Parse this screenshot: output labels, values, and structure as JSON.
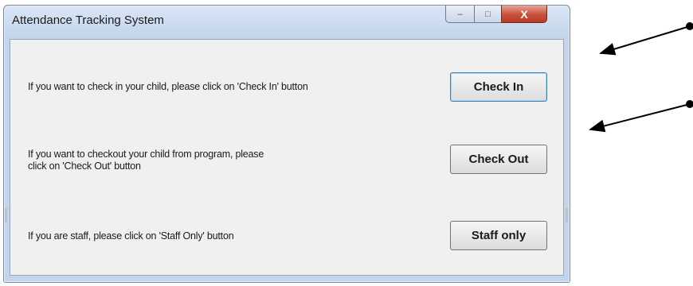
{
  "window": {
    "title": "Attendance Tracking System",
    "controls": {
      "minimize": "–",
      "maximize": "□",
      "close": "X"
    }
  },
  "rows": [
    {
      "text": "If you want to check in your child, please click on 'Check In' button",
      "button": "Check In"
    },
    {
      "text": "If you want to checkout your child from program, please\nclick on 'Check Out' button",
      "button": "Check Out"
    },
    {
      "text": "If you are staff, please click on 'Staff Only' button",
      "button": "Staff only"
    }
  ],
  "annotation": {
    "arrow_color": "#000000"
  }
}
